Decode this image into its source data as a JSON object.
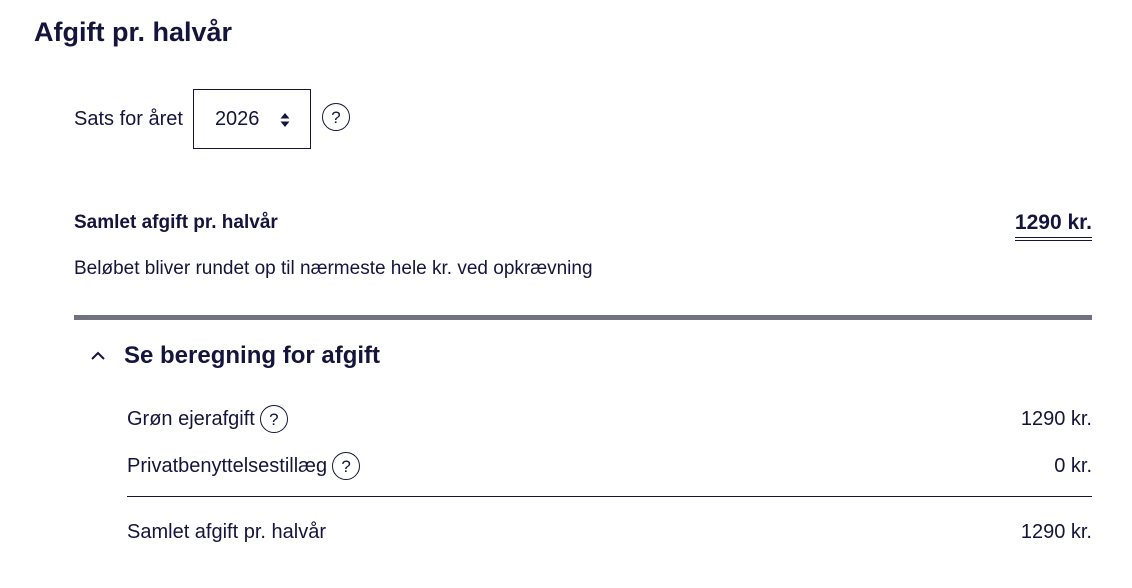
{
  "page_title": "Afgift pr. halvår",
  "year_select": {
    "label": "Sats for året",
    "value": "2026"
  },
  "total": {
    "label": "Samlet afgift pr. halvår",
    "value": "1290 kr.",
    "note": "Beløbet bliver rundet op til nærmeste hele kr. ved opkrævning"
  },
  "calculation": {
    "title": "Se beregning for afgift",
    "expanded": true,
    "rows": [
      {
        "label": "Grøn ejerafgift",
        "value": "1290 kr."
      },
      {
        "label": "Privatbenyttelsestillæg",
        "value": "0 kr."
      }
    ],
    "sum_label": "Samlet afgift pr. halvår",
    "sum_value": "1290 kr."
  },
  "help_icon_glyph": "?",
  "colors": {
    "text": "#14143c",
    "divider": "#71717f",
    "background": "#ffffff"
  }
}
